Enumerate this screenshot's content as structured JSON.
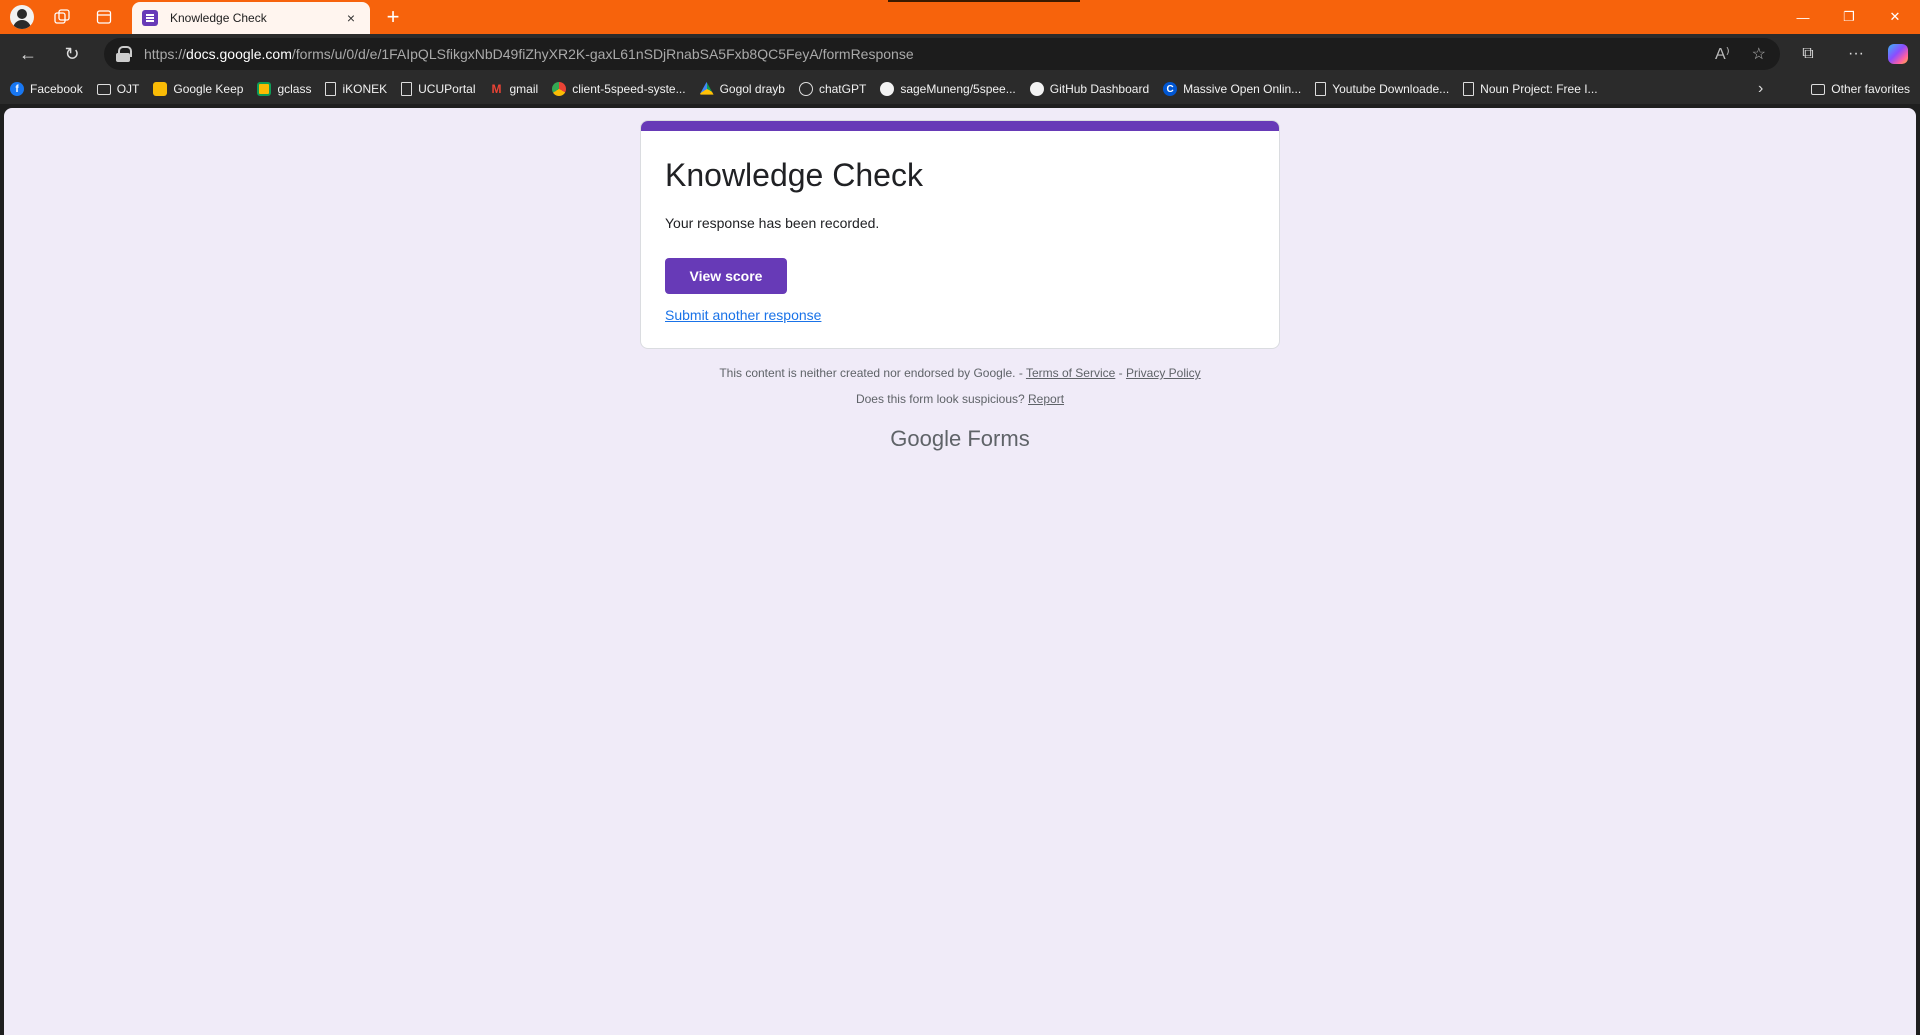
{
  "browser": {
    "tab": {
      "title": "Knowledge Check",
      "close": "×"
    },
    "new_tab": "+",
    "window": {
      "minimize": "—",
      "restore": "❐",
      "close": "✕"
    },
    "nav": {
      "back": "←",
      "refresh": "↻"
    },
    "address": {
      "prefix": "https://",
      "host": "docs.google.com",
      "path": "/forms/u/0/d/e/1FAIpQLSfikgxNbD49fiZhyXR2K-gaxL61nSDjRnabSA5Fxb8QC5FeyA/formResponse"
    },
    "address_icons": {
      "read_aloud": "A⁾",
      "favorite": "☆"
    },
    "toolbar_icons": {
      "extensions": "⧉",
      "more": "···"
    }
  },
  "bookmarks": [
    {
      "label": "Facebook",
      "icon": "facebook-icon"
    },
    {
      "label": "OJT",
      "icon": "folder-icon"
    },
    {
      "label": "Google Keep",
      "icon": "google-keep-icon"
    },
    {
      "label": "gclass",
      "icon": "google-classroom-icon"
    },
    {
      "label": "iKONEK",
      "icon": "page-icon"
    },
    {
      "label": "UCUPortal",
      "icon": "page-icon"
    },
    {
      "label": "gmail",
      "icon": "gmail-icon"
    },
    {
      "label": "client-5speed-syste...",
      "icon": "chrome-icon"
    },
    {
      "label": "Gogol drayb",
      "icon": "google-drive-icon"
    },
    {
      "label": "chatGPT",
      "icon": "chatgpt-icon"
    },
    {
      "label": "sageMuneng/5spee...",
      "icon": "github-icon"
    },
    {
      "label": "GitHub Dashboard",
      "icon": "github-icon"
    },
    {
      "label": "Massive Open Onlin...",
      "icon": "coursera-icon"
    },
    {
      "label": "Youtube Downloade...",
      "icon": "page-icon"
    },
    {
      "label": "Noun Project: Free I...",
      "icon": "page-icon"
    }
  ],
  "bookmarks_more": "›",
  "other_favorites": "Other favorites",
  "form": {
    "title": "Knowledge Check",
    "message": "Your response has been recorded.",
    "view_score": "View score",
    "submit_another": "Submit another response",
    "accent_color": "#673ab7",
    "background_color": "#f0ebf8"
  },
  "footer": {
    "disclaimer": "This content is neither created nor endorsed by Google. - ",
    "terms": "Terms of Service",
    "separator": " - ",
    "privacy": "Privacy Policy",
    "suspicious": "Does this form look suspicious? ",
    "report": "Report",
    "brand_google": "Google",
    "brand_forms": " Forms"
  }
}
